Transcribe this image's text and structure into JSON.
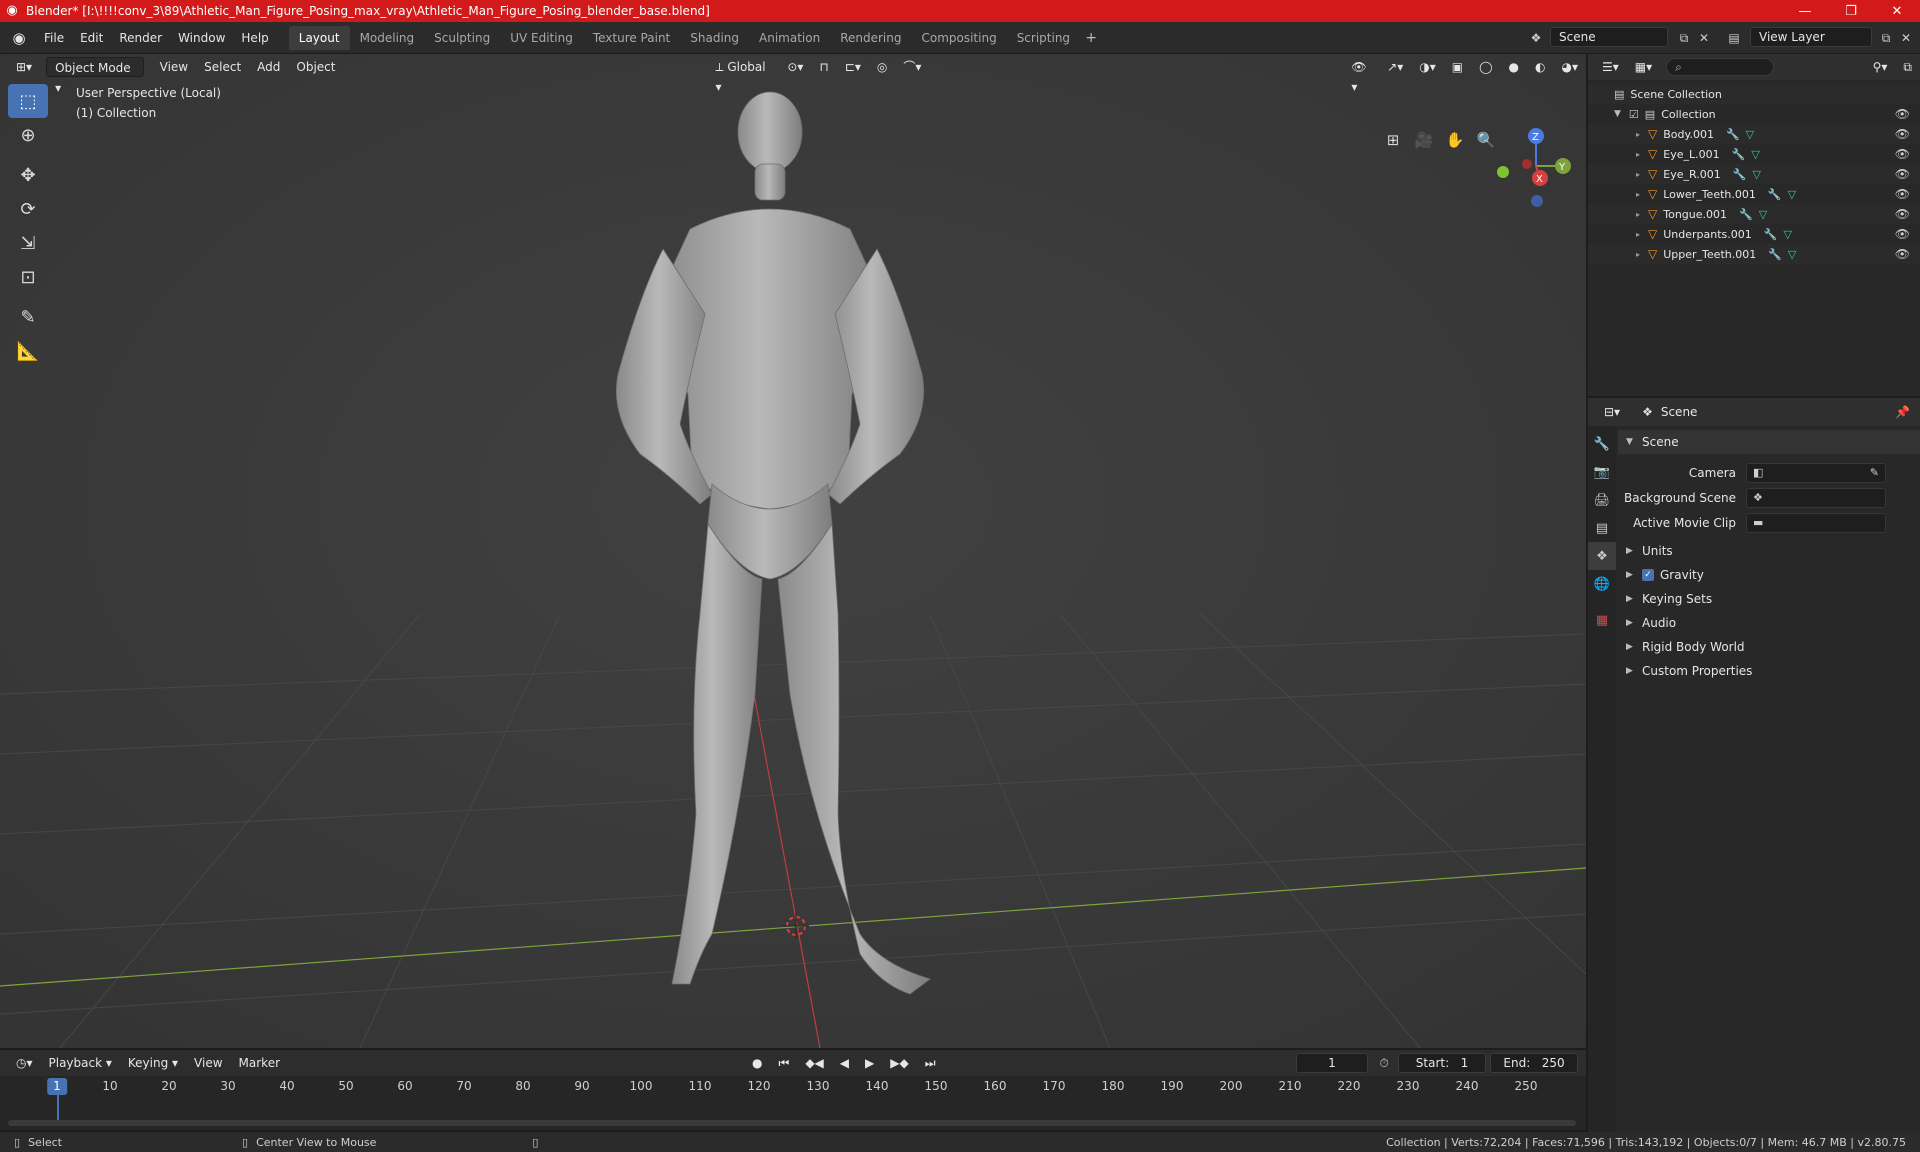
{
  "titlebar": {
    "title": "Blender* [I:\\!!!!conv_3\\89\\Athletic_Man_Figure_Posing_max_vray\\Athletic_Man_Figure_Posing_blender_base.blend]"
  },
  "menu": [
    "File",
    "Edit",
    "Render",
    "Window",
    "Help"
  ],
  "workspaces": [
    "Layout",
    "Modeling",
    "Sculpting",
    "UV Editing",
    "Texture Paint",
    "Shading",
    "Animation",
    "Rendering",
    "Compositing",
    "Scripting"
  ],
  "active_workspace": "Layout",
  "scene_name": "Scene",
  "view_layer": "View Layer",
  "viewport": {
    "mode": "Object Mode",
    "menus": [
      "View",
      "Select",
      "Add",
      "Object"
    ],
    "orientation": "Global",
    "perspective_label": "User Perspective (Local)",
    "collection_label": "(1) Collection",
    "gizmo": {
      "z": "Z",
      "y": "Y",
      "x": "X"
    }
  },
  "outliner": {
    "root": "Scene Collection",
    "collection": "Collection",
    "objects": [
      "Body.001",
      "Eye_L.001",
      "Eye_R.001",
      "Lower_Teeth.001",
      "Tongue.001",
      "Underpants.001",
      "Upper_Teeth.001"
    ]
  },
  "properties": {
    "context": "Scene",
    "panel_scene": "Scene",
    "camera_label": "Camera",
    "bg_scene_label": "Background Scene",
    "movie_clip_label": "Active Movie Clip",
    "panels": [
      "Units",
      "Gravity",
      "Keying Sets",
      "Audio",
      "Rigid Body World",
      "Custom Properties"
    ]
  },
  "timeline": {
    "menus": [
      "Playback",
      "Keying",
      "View",
      "Marker"
    ],
    "current_frame": "1",
    "start_label": "Start:",
    "start": "1",
    "end_label": "End:",
    "end": "250",
    "ruler": [
      "10",
      "20",
      "30",
      "40",
      "50",
      "60",
      "70",
      "80",
      "90",
      "100",
      "110",
      "120",
      "130",
      "140",
      "150",
      "160",
      "170",
      "180",
      "190",
      "200",
      "210",
      "220",
      "230",
      "240",
      "250"
    ],
    "cursor_label": "1"
  },
  "statusbar": {
    "left": "Select",
    "middle": "Center View to Mouse",
    "right": "Collection | Verts:72,204 | Faces:71,596 | Tris:143,192 | Objects:0/7 | Mem: 46.7 MB | v2.80.75"
  }
}
